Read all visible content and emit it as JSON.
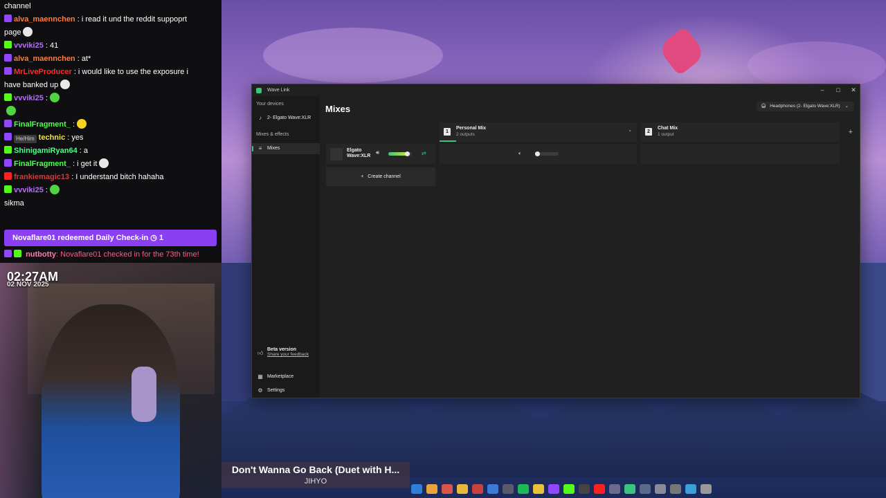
{
  "chat": {
    "lines": [
      {
        "badge": "",
        "user": "",
        "text": "channel",
        "emotes": []
      },
      {
        "badge": "purple",
        "user": "alva_maennchen",
        "user_color": "#ff7a3d",
        "text": ": i read it und the reddit suppoprt",
        "emotes": []
      },
      {
        "badge": "",
        "user": "",
        "text": "page",
        "emotes": [
          "white"
        ]
      },
      {
        "badge": "green",
        "user": "vvviki25",
        "user_color": "#b86bff",
        "text": ": 41",
        "emotes": []
      },
      {
        "badge": "purple",
        "user": "alva_maennchen",
        "user_color": "#ff7a3d",
        "text": ": at*",
        "emotes": []
      },
      {
        "badge": "purple",
        "user": "MrLiveProducer",
        "user_color": "#ff2d2d",
        "text": ": i would like to use the exposure i",
        "emotes": []
      },
      {
        "badge": "",
        "user": "",
        "text": "have banked up",
        "emotes": [
          "white"
        ]
      },
      {
        "badge": "green",
        "user": "vvviki25",
        "user_color": "#b86bff",
        "text": ":",
        "emotes": [
          "green"
        ]
      },
      {
        "badge": "",
        "user": "",
        "text": "",
        "emotes": [
          "green"
        ]
      },
      {
        "badge": "purple",
        "user": "FinalFragment_",
        "user_color": "#4cff4c",
        "text": ":",
        "emotes": [
          "yellow"
        ]
      },
      {
        "badge": "purple",
        "user": "technic",
        "user_color": "#f5e14a",
        "pronoun": "He/Him",
        "text": ": yes",
        "emotes": []
      },
      {
        "badge": "green",
        "user": "ShinigamiRyan64",
        "user_color": "#4cff8a",
        "text": ": a",
        "emotes": []
      },
      {
        "badge": "purple",
        "user": "FinalFragment_",
        "user_color": "#4cff4c",
        "text": ": i get it",
        "emotes": [
          "white"
        ]
      },
      {
        "badge": "red",
        "user": "frankiemagic13",
        "user_color": "#d43b3b",
        "text": ": I understand bitch hahaha",
        "emotes": []
      },
      {
        "badge": "green",
        "user": "vvviki25",
        "user_color": "#b86bff",
        "text": ":",
        "emotes": [
          "green"
        ]
      },
      {
        "badge": "",
        "user": "",
        "text": "sikma",
        "emotes": []
      }
    ],
    "redeem": "Novaflare01 redeemed Daily Check-in ◷ 1",
    "bot_user": "nutbotty",
    "bot_text": ": Novaflare01 checked in for the 73th time!"
  },
  "cam": {
    "time": "02:27AM",
    "date": "02 NOV 2025"
  },
  "now_playing": {
    "title": "Don't Wanna Go Back (Duet with H...",
    "artist": "JIHYO"
  },
  "window": {
    "title": "Wave Link",
    "controls": {
      "minimize": "–",
      "maximize": "□",
      "close": "✕"
    },
    "sidebar": {
      "your_devices": "Your devices",
      "device": "2- Elgato Wave:XLR",
      "mixes_effects": "Mixes & effects",
      "mixes": "Mixes",
      "beta_title": "Beta version",
      "beta_link": "Share your feedback",
      "marketplace": "Marketplace",
      "settings": "Settings"
    },
    "main": {
      "title": "Mixes",
      "output": "Headphones (2- Elgato Wave:XLR)",
      "mixes": [
        {
          "num": "1",
          "name": "Personal Mix",
          "sub": "2 outputs",
          "level": 0.1
        },
        {
          "num": "2",
          "name": "Chat Mix",
          "sub": "1 output"
        }
      ],
      "channel": {
        "name": "Elgato Wave:XLR",
        "level": 0.8
      },
      "create_channel": "Create channel"
    }
  },
  "colors": {
    "accent": "#3cc47f",
    "window_bg": "#202020",
    "twitch": "#9146ff"
  }
}
